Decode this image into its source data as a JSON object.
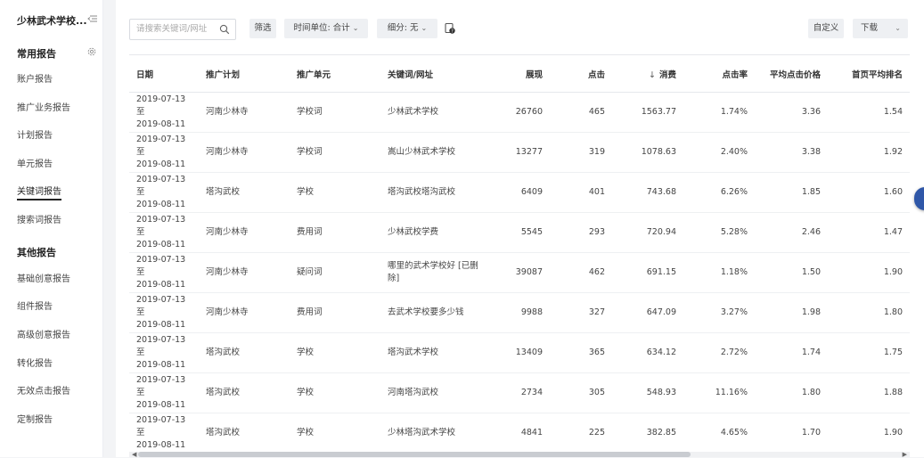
{
  "sidebar": {
    "title": "少林武术学校...",
    "sections": [
      {
        "label": "常用报告",
        "items": [
          "账户报告",
          "推广业务报告",
          "计划报告",
          "单元报告",
          "关键词报告",
          "搜索词报告"
        ]
      },
      {
        "label": "其他报告",
        "items": [
          "基础创意报告",
          "组件报告",
          "高级创意报告",
          "转化报告",
          "无效点击报告",
          "定制报告"
        ]
      }
    ],
    "active_item": "关键词报告"
  },
  "toolbar": {
    "search_placeholder": "请搜索关键词/网址",
    "filter_label": "筛选",
    "time_unit_label": "时间单位: 合计",
    "breakdown_label": "细分: 无",
    "customize_label": "自定义",
    "download_label": "下载"
  },
  "table": {
    "columns": [
      "日期",
      "推广计划",
      "推广单元",
      "关键词/网址",
      "展现",
      "点击",
      "消费",
      "点击率",
      "平均点击价格",
      "首页平均排名"
    ],
    "sorted_column": "消费",
    "sort_direction": "desc",
    "rows": [
      {
        "date_start": "2019-07-13至",
        "date_end": "2019-08-11",
        "plan": "河南少林寺",
        "unit": "学校词",
        "keyword": "少林武术学校",
        "impressions": "26760",
        "clicks": "465",
        "cost": "1563.77",
        "ctr": "1.74%",
        "avg_cpc": "3.36",
        "avg_rank": "1.54"
      },
      {
        "date_start": "2019-07-13至",
        "date_end": "2019-08-11",
        "plan": "河南少林寺",
        "unit": "学校词",
        "keyword": "嵩山少林武术学校",
        "impressions": "13277",
        "clicks": "319",
        "cost": "1078.63",
        "ctr": "2.40%",
        "avg_cpc": "3.38",
        "avg_rank": "1.92"
      },
      {
        "date_start": "2019-07-13至",
        "date_end": "2019-08-11",
        "plan": "塔沟武校",
        "unit": "学校",
        "keyword": "塔沟武校塔沟武校",
        "impressions": "6409",
        "clicks": "401",
        "cost": "743.68",
        "ctr": "6.26%",
        "avg_cpc": "1.85",
        "avg_rank": "1.60"
      },
      {
        "date_start": "2019-07-13至",
        "date_end": "2019-08-11",
        "plan": "河南少林寺",
        "unit": "费用词",
        "keyword": "少林武校学费",
        "impressions": "5545",
        "clicks": "293",
        "cost": "720.94",
        "ctr": "5.28%",
        "avg_cpc": "2.46",
        "avg_rank": "1.47"
      },
      {
        "date_start": "2019-07-13至",
        "date_end": "2019-08-11",
        "plan": "河南少林寺",
        "unit": "疑问词",
        "keyword": "哪里的武术学校好 [已删除]",
        "impressions": "39087",
        "clicks": "462",
        "cost": "691.15",
        "ctr": "1.18%",
        "avg_cpc": "1.50",
        "avg_rank": "1.90"
      },
      {
        "date_start": "2019-07-13至",
        "date_end": "2019-08-11",
        "plan": "河南少林寺",
        "unit": "费用词",
        "keyword": "去武术学校要多少钱",
        "impressions": "9988",
        "clicks": "327",
        "cost": "647.09",
        "ctr": "3.27%",
        "avg_cpc": "1.98",
        "avg_rank": "1.80"
      },
      {
        "date_start": "2019-07-13至",
        "date_end": "2019-08-11",
        "plan": "塔沟武校",
        "unit": "学校",
        "keyword": "塔沟武术学校",
        "impressions": "13409",
        "clicks": "365",
        "cost": "634.12",
        "ctr": "2.72%",
        "avg_cpc": "1.74",
        "avg_rank": "1.75"
      },
      {
        "date_start": "2019-07-13至",
        "date_end": "2019-08-11",
        "plan": "塔沟武校",
        "unit": "学校",
        "keyword": "河南塔沟武校",
        "impressions": "2734",
        "clicks": "305",
        "cost": "548.93",
        "ctr": "11.16%",
        "avg_cpc": "1.80",
        "avg_rank": "1.88"
      },
      {
        "date_start": "2019-07-13至",
        "date_end": "2019-08-11",
        "plan": "塔沟武校",
        "unit": "学校",
        "keyword": "少林塔沟武术学校",
        "impressions": "4841",
        "clicks": "225",
        "cost": "382.85",
        "ctr": "4.65%",
        "avg_cpc": "1.70",
        "avg_rank": "1.90"
      }
    ]
  },
  "colors": {
    "background": "#f3f4f6",
    "panel": "#ffffff",
    "button_bg": "#eef0f3",
    "float_widget": "#2f57a8"
  },
  "icons": {
    "collapse": "menu-collapse-icon",
    "settings": "gear-icon",
    "search": "search-icon",
    "help": "help-icon",
    "sort": "arrow-down-icon"
  }
}
